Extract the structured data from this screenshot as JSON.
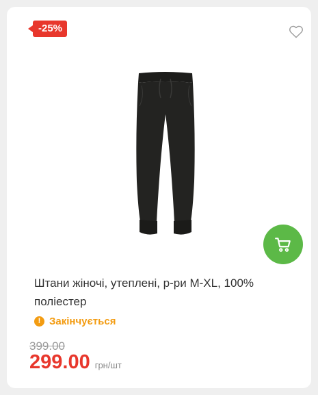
{
  "product": {
    "discount_badge": "-25%",
    "title": "Штани жіночі, утеплені, р-ри M-XL, 100% поліестер",
    "stock_status": "Закінчується",
    "old_price": "399.00",
    "price": "299.00",
    "unit": "грн/шт",
    "image_alt": "black women's pants"
  },
  "icons": {
    "favorite": "heart-outline-icon",
    "cart": "shopping-cart-icon",
    "stock": "exclamation-icon"
  },
  "colors": {
    "badge": "#e8372c",
    "price": "#e8372c",
    "cart_button": "#5cb947",
    "stock_warning": "#f39c12"
  }
}
